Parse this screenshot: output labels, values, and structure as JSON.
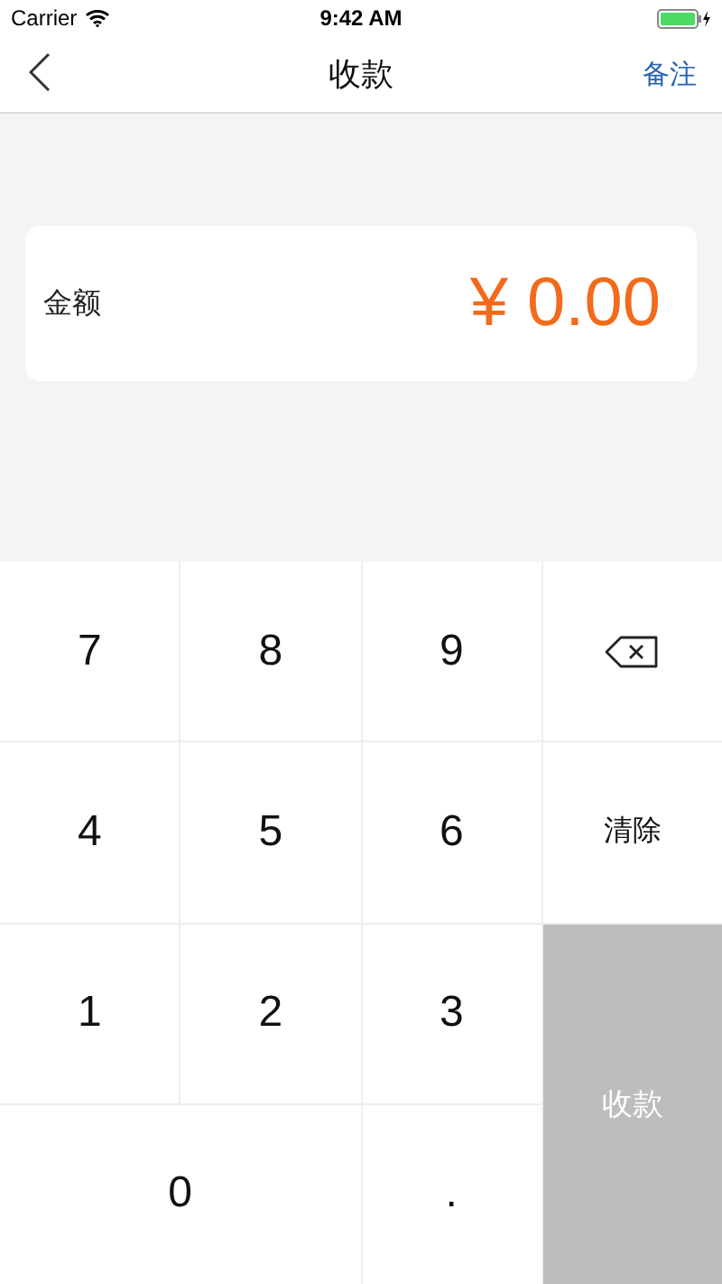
{
  "status_bar": {
    "carrier": "Carrier",
    "time": "9:42 AM"
  },
  "nav": {
    "title": "收款",
    "action": "备注"
  },
  "amount": {
    "label": "金额",
    "value": "¥ 0.00"
  },
  "keys": [
    {
      "kind": "digit",
      "label": "7"
    },
    {
      "kind": "digit",
      "label": "8"
    },
    {
      "kind": "digit",
      "label": "9"
    },
    {
      "kind": "backspace"
    },
    {
      "kind": "digit",
      "label": "4"
    },
    {
      "kind": "digit",
      "label": "5"
    },
    {
      "kind": "digit",
      "label": "6"
    },
    {
      "kind": "clear",
      "label": "清除"
    },
    {
      "kind": "digit",
      "label": "1"
    },
    {
      "kind": "digit",
      "label": "2"
    },
    {
      "kind": "digit",
      "label": "3"
    },
    {
      "kind": "submit",
      "label": "收款",
      "disabled": true
    },
    {
      "kind": "wide",
      "label": "0"
    },
    {
      "kind": "digit",
      "label": "."
    }
  ]
}
